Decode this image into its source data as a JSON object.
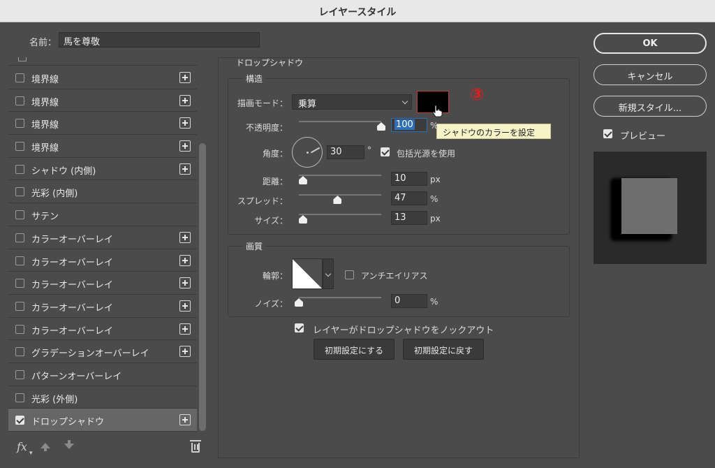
{
  "window": {
    "title": "レイヤースタイル"
  },
  "name_field": {
    "label": "名前：",
    "value": "馬を尊敬"
  },
  "effects": [
    {
      "label": "境界線",
      "checked": false,
      "has_plus": true
    },
    {
      "label": "境界線",
      "checked": false,
      "has_plus": true
    },
    {
      "label": "境界線",
      "checked": false,
      "has_plus": true
    },
    {
      "label": "境界線",
      "checked": false,
      "has_plus": true
    },
    {
      "label": "シャドウ (内側)",
      "checked": false,
      "has_plus": true
    },
    {
      "label": "光彩 (内側)",
      "checked": false,
      "has_plus": false
    },
    {
      "label": "サテン",
      "checked": false,
      "has_plus": false
    },
    {
      "label": "カラーオーバーレイ",
      "checked": false,
      "has_plus": true
    },
    {
      "label": "カラーオーバーレイ",
      "checked": false,
      "has_plus": true
    },
    {
      "label": "カラーオーバーレイ",
      "checked": false,
      "has_plus": true
    },
    {
      "label": "カラーオーバーレイ",
      "checked": false,
      "has_plus": true
    },
    {
      "label": "カラーオーバーレイ",
      "checked": false,
      "has_plus": true
    },
    {
      "label": "グラデーションオーバーレイ",
      "checked": false,
      "has_plus": true
    },
    {
      "label": "パターンオーバーレイ",
      "checked": false,
      "has_plus": false
    },
    {
      "label": "光彩 (外側)",
      "checked": false,
      "has_plus": false
    },
    {
      "label": "ドロップシャドウ",
      "checked": true,
      "has_plus": true,
      "active": true
    }
  ],
  "bottom_toolbar": {
    "fx_label": "fx"
  },
  "drop_shadow": {
    "title": "ドロップシャドウ",
    "structure": {
      "title": "構造",
      "blend_mode_label": "描画モード：",
      "blend_mode_value": "乗算",
      "shadow_color": "#000000",
      "step_marker": "③",
      "tooltip": "シャドウのカラーを設定",
      "opacity_label": "不透明度：",
      "opacity_value": "100",
      "opacity_unit": "%",
      "opacity_level": 1.0,
      "angle_label": "角度：",
      "angle_value": "30",
      "angle_unit": "°",
      "global_light_label": "包括光源を使用",
      "global_light_checked": true,
      "distance_label": "距離：",
      "distance_value": "10",
      "distance_unit": "px",
      "distance_level": 0.05,
      "spread_label": "スプレッド：",
      "spread_value": "47",
      "spread_unit": "%",
      "spread_level": 0.47,
      "size_label": "サイズ：",
      "size_value": "13",
      "size_unit": "px",
      "size_level": 0.05
    },
    "quality": {
      "title": "画質",
      "contour_label": "輪郭：",
      "anti_alias_label": "アンチエイリアス",
      "anti_alias_checked": false,
      "noise_label": "ノイズ：",
      "noise_value": "0",
      "noise_unit": "%",
      "noise_level": 0.0
    },
    "knockout_label": "レイヤーがドロップシャドウをノックアウト",
    "knockout_checked": true,
    "make_default_label": "初期設定にする",
    "reset_default_label": "初期設定に戻す"
  },
  "right_panel": {
    "ok_label": "OK",
    "cancel_label": "キャンセル",
    "new_style_label": "新規スタイル...",
    "preview_label": "プレビュー",
    "preview_checked": true
  },
  "colors": {
    "dialog_bg": "#4b4b4b",
    "accent_blue": "#2d6fb8",
    "annotation_red": "#e11d1d",
    "tooltip_bg": "#f6f3c8"
  }
}
